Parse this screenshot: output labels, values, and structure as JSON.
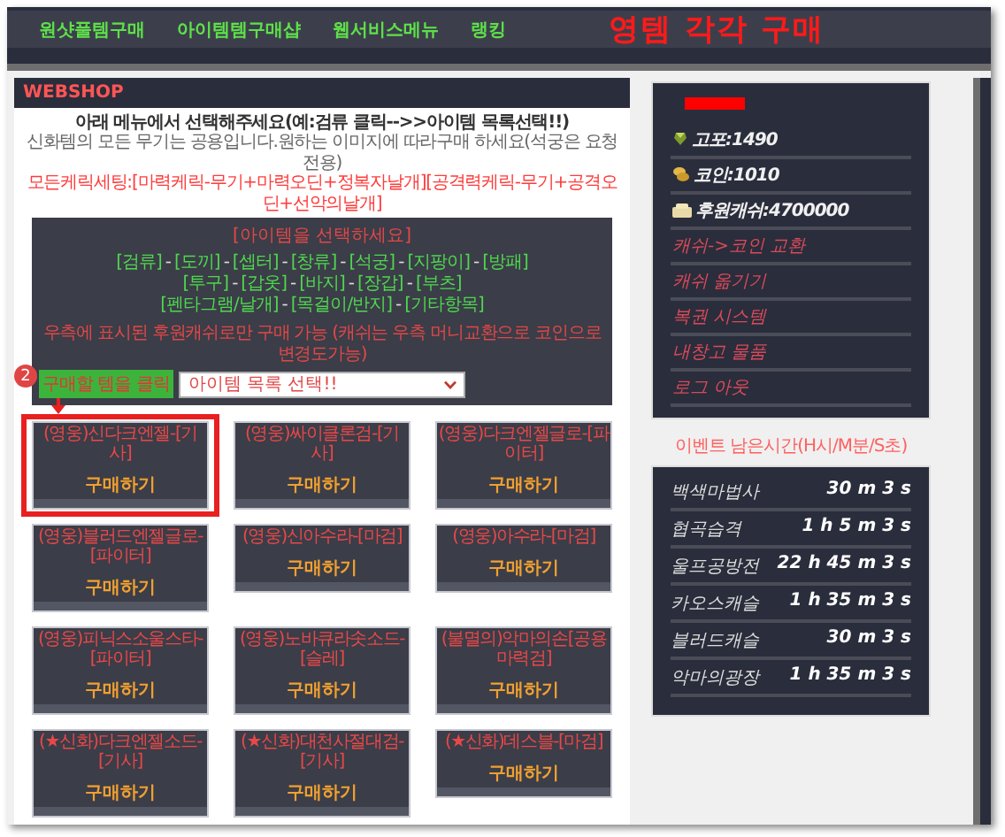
{
  "nav": {
    "items": [
      "원샷풀템구매",
      "아이템템구매샵",
      "웹서비스메뉴",
      "랭킹"
    ],
    "title": "영템 각각 구매"
  },
  "webshop": {
    "title": "WEBSHOP",
    "instructions": [
      {
        "kind": "heading",
        "text": "아래 메뉴에서 선택해주세요(예:검류 클릭-->>아이템 목록선택!!)"
      },
      {
        "kind": "note",
        "text": "신화템의 모든 무기는 공용입니다.원하는 이미지에 따라구매 하세요(석궁은 요청전용)"
      },
      {
        "kind": "warning",
        "text": "모든케릭세팅:[마력케릭-무기+마력오딘+정복자날개][공격력케릭-무기+공격오딘+선악의날개]"
      }
    ],
    "selector": {
      "title": "[아이템을 선택하세요]",
      "separator": "-",
      "category_rows": [
        [
          "[검류]",
          "[도끼]",
          "[셉터]",
          "[창류]",
          "[석궁]",
          "[지팡이]",
          "[방패]"
        ],
        [
          "[투구]",
          "[갑옷]",
          "[바지]",
          "[장갑]",
          "[부츠]"
        ],
        [
          "[펜타그램/날개]",
          "[목걸이/반지]",
          "[기타항목]"
        ]
      ],
      "notice": "우측에 표시된 후원캐쉬로만 구매 가능 (캐쉬는 우측 머니교환으로 코인으로 변경도가능)",
      "dropdown": {
        "value": "아이템 목록 선택!!"
      }
    },
    "items": [
      {
        "name": "(영웅)신다크엔젤-[기사]",
        "button": "구매하기",
        "highlighted": true
      },
      {
        "name": "(영웅)싸이클론검-[기사]",
        "button": "구매하기",
        "highlighted": false
      },
      {
        "name": "(영웅)다크엔젤글로-[파이터]",
        "button": "구매하기",
        "highlighted": false
      },
      {
        "name": "(영웅)블러드엔젤글로-[파이터]",
        "button": "구매하기",
        "highlighted": false
      },
      {
        "name": "(영웅)신아수라-[마검]",
        "button": "구매하기",
        "highlighted": false
      },
      {
        "name": "(영웅)아수라-[마검]",
        "button": "구매하기",
        "highlighted": false
      },
      {
        "name": "(영웅)피닉스소울스타-[파이터]",
        "button": "구매하기",
        "highlighted": false
      },
      {
        "name": "(영웅)노바큐라솟소드-[슬레]",
        "button": "구매하기",
        "highlighted": false
      },
      {
        "name": "(불멸의)악마의손[공용마력검]",
        "button": "구매하기",
        "highlighted": false
      },
      {
        "name": "(★신화)다크엔젤소드-[기사]",
        "button": "구매하기",
        "highlighted": false
      },
      {
        "name": "(★신화)대천사절대검-[기사]",
        "button": "구매하기",
        "highlighted": false
      },
      {
        "name": "(★신화)데스블-[마검]",
        "button": "구매하기",
        "highlighted": false
      }
    ]
  },
  "annotation": {
    "step": "2",
    "label": "구매할 템을 클릭"
  },
  "account": {
    "balances": [
      {
        "kind": "gem",
        "label": "고포:",
        "value": "1490"
      },
      {
        "kind": "coin",
        "label": "코인:",
        "value": "1010"
      },
      {
        "kind": "cash",
        "label": "후원캐쉬:",
        "value": "4700000"
      }
    ],
    "links": [
      "캐쉬->코인 교환",
      "캐쉬 옮기기",
      "복권 시스템",
      "내창고 물품",
      "로그 아웃"
    ]
  },
  "event_timer": {
    "title": "이벤트 남은시간(H시/M분/S초)",
    "events": [
      {
        "name": "백색마법사",
        "time": "30 m 3 s"
      },
      {
        "name": "협곡습격",
        "time": "1 h 5 m 3 s"
      },
      {
        "name": "울프공방전",
        "time": "22 h 45 m 3 s"
      },
      {
        "name": "카오스캐슬",
        "time": "1 h 35 m 3 s"
      },
      {
        "name": "블러드캐슬",
        "time": "30 m 3 s"
      },
      {
        "name": "악마의광장",
        "time": "1 h 35 m 3 s"
      }
    ]
  }
}
